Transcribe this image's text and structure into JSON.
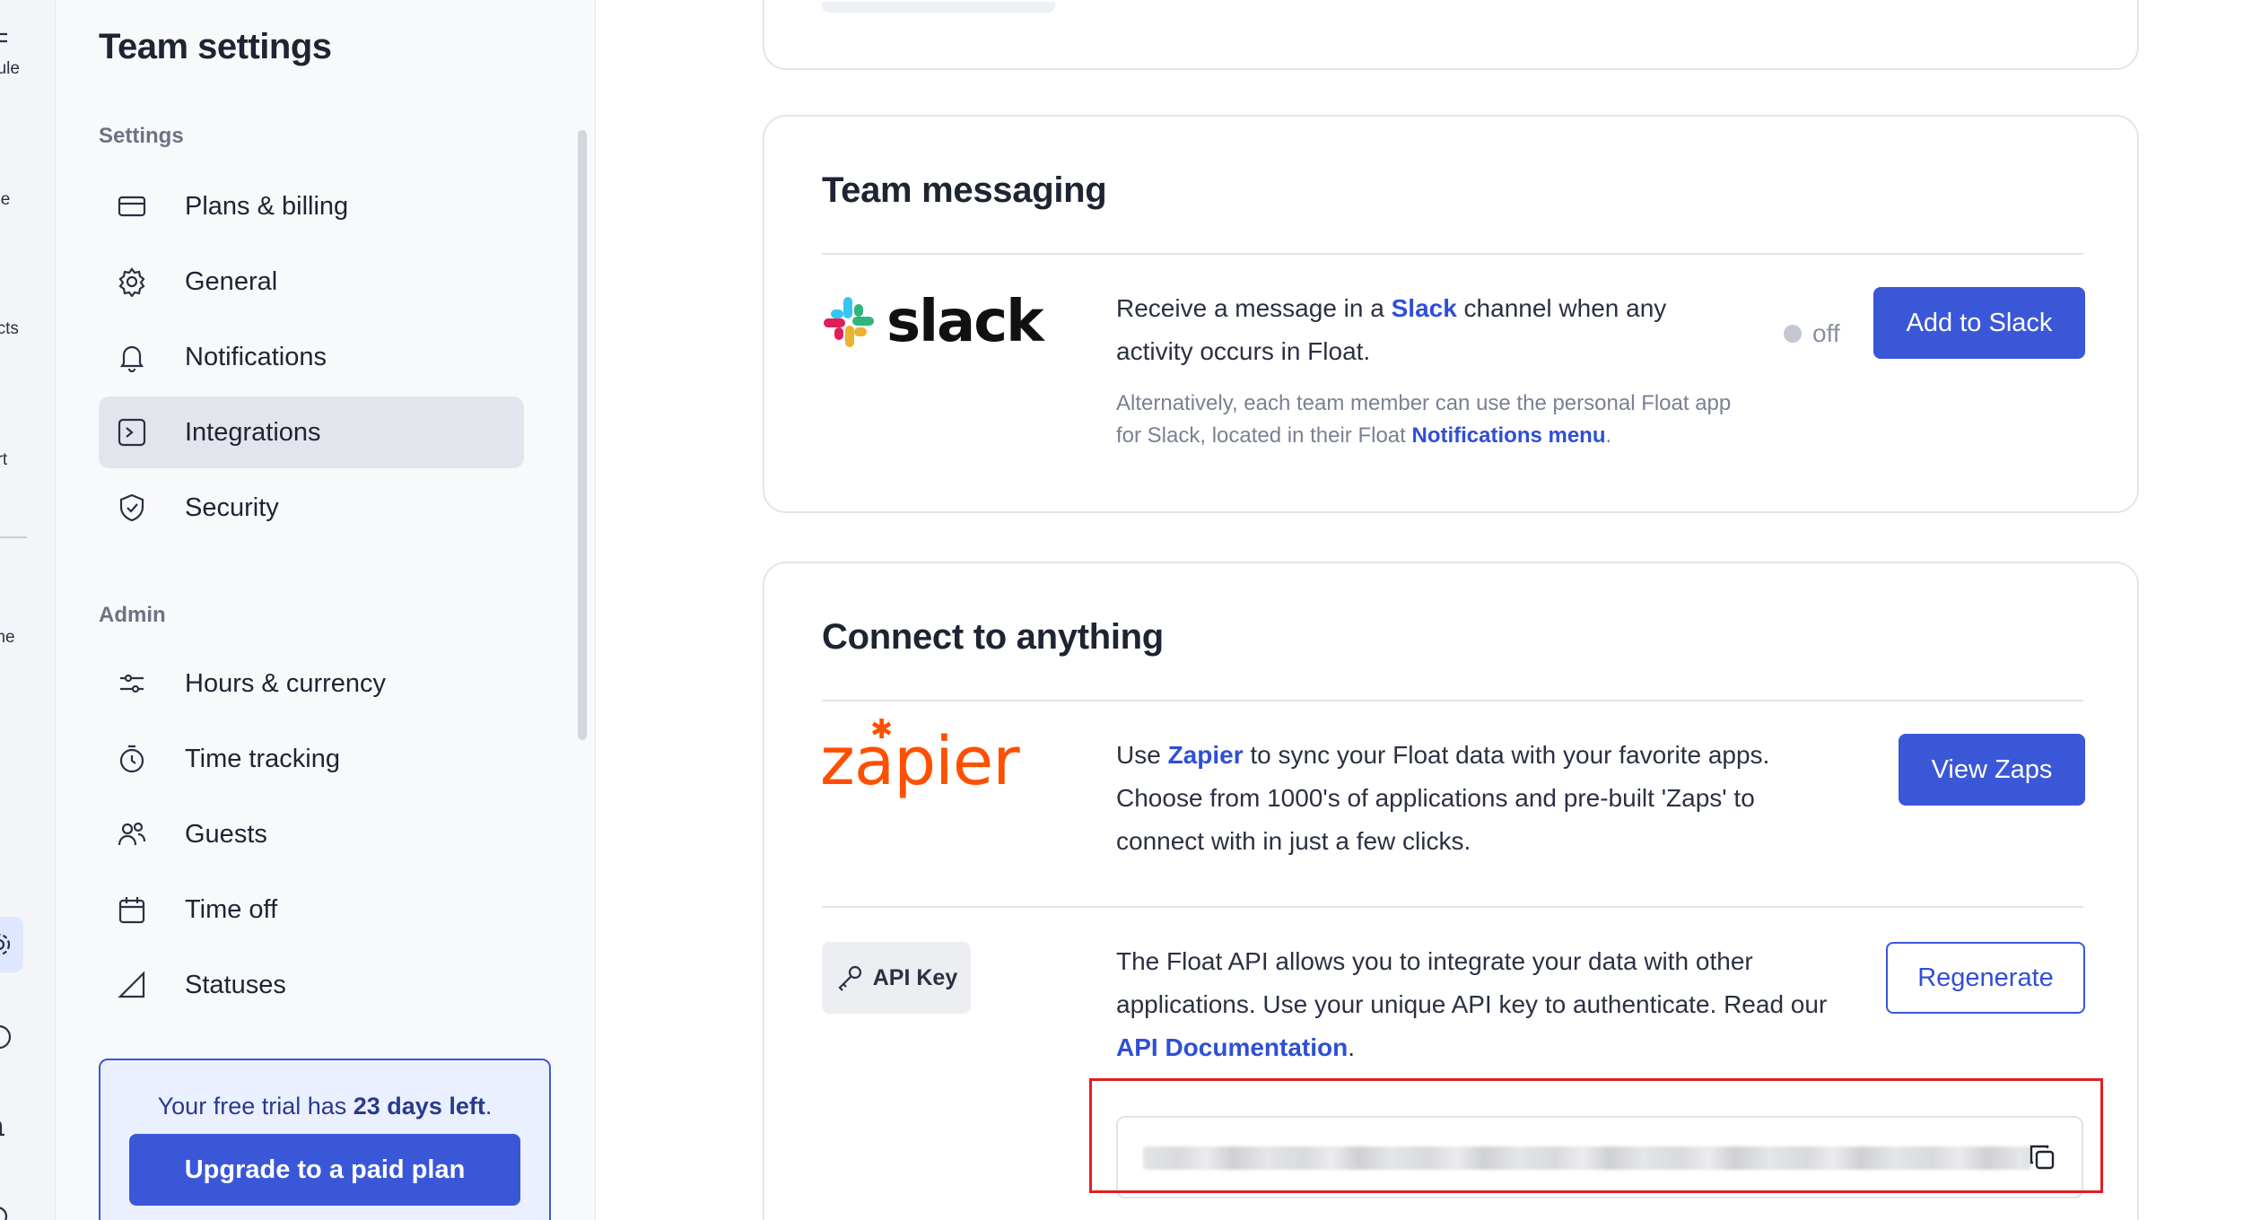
{
  "rail": {
    "items": [
      {
        "label": "dule",
        "icon": "schedule-icon"
      },
      {
        "label": "ple",
        "icon": "people-icon"
      },
      {
        "label": "ects",
        "icon": "projects-icon"
      },
      {
        "label": "ort",
        "icon": "report-icon"
      },
      {
        "label": "ime",
        "icon": "time-icon"
      }
    ]
  },
  "sidebar": {
    "title": "Team settings",
    "settings_label": "Settings",
    "settings_items": [
      {
        "label": "Plans & billing",
        "icon": "credit-card-icon"
      },
      {
        "label": "General",
        "icon": "gear-icon"
      },
      {
        "label": "Notifications",
        "icon": "bell-icon"
      },
      {
        "label": "Integrations",
        "icon": "terminal-icon",
        "active": true
      },
      {
        "label": "Security",
        "icon": "shield-check-icon"
      }
    ],
    "admin_label": "Admin",
    "admin_items": [
      {
        "label": "Hours & currency",
        "icon": "sliders-icon"
      },
      {
        "label": "Time tracking",
        "icon": "stopwatch-icon"
      },
      {
        "label": "Guests",
        "icon": "guests-icon"
      },
      {
        "label": "Time off",
        "icon": "calendar-icon"
      },
      {
        "label": "Statuses",
        "icon": "triangle-icon"
      }
    ],
    "trial": {
      "prefix": "Your free trial has ",
      "days": "23 days left",
      "suffix": ".",
      "upgrade_label": "Upgrade to a paid plan"
    }
  },
  "team_messaging": {
    "title": "Team messaging",
    "slack_wordmark": "slack",
    "desc_prefix": "Receive a message in a ",
    "desc_link": "Slack",
    "desc_suffix": " channel when any activity occurs in Float.",
    "note_prefix": "Alternatively, each team member can use the personal Float app for Slack, located in their Float ",
    "note_link": "Notifications menu",
    "note_suffix": ".",
    "toggle_label": "off",
    "button_label": "Add to Slack"
  },
  "connect": {
    "title": "Connect to anything",
    "zapier_wordmark": "zapier",
    "zapier_prefix": "Use ",
    "zapier_link": "Zapier",
    "zapier_suffix": " to sync your Float data with your favorite apps. Choose from 1000's of applications and pre-built 'Zaps' to connect with in just a few clicks.",
    "view_zaps_label": "View Zaps",
    "api_badge_label": "API Key",
    "api_prefix": "The Float API allows you to integrate your data with other applications. Use your unique API key to authenticate. Read our ",
    "api_link": "API Documentation",
    "api_suffix": ".",
    "regenerate_label": "Regenerate"
  },
  "colors": {
    "accent": "#3a57d8",
    "link": "#2f4fd6",
    "zapier": "#ff4f00",
    "highlight": "#e02020"
  }
}
